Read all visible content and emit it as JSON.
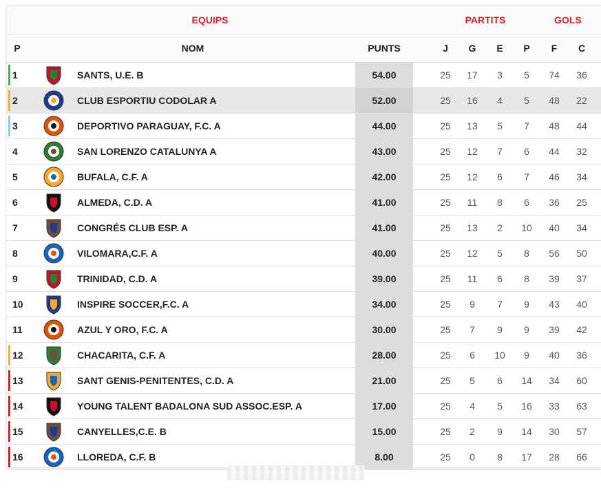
{
  "group_headers": {
    "equips": "EQUIPS",
    "partits": "PARTITS",
    "gols": "GOLS"
  },
  "columns": {
    "p": "P",
    "nom": "NOM",
    "punts": "PUNTS",
    "j": "J",
    "g": "G",
    "e": "E",
    "pp": "P",
    "f": "F",
    "c": "C"
  },
  "colors": {
    "accent": "#d6212a",
    "green": "#4caf50",
    "yellow": "#f0b429",
    "blue": "#8ecfe3",
    "red": "#c62828"
  },
  "rows": [
    {
      "pos": "1",
      "name": "SANTS, U.E. B",
      "pts": "54.00",
      "j": "25",
      "g": "17",
      "e": "3",
      "p": "5",
      "f": "74",
      "c": "36",
      "bar": "#4caf50",
      "crest": "shield-icon"
    },
    {
      "pos": "2",
      "name": "CLUB ESPORTIU CODOLAR A",
      "pts": "52.00",
      "j": "25",
      "g": "16",
      "e": "4",
      "p": "5",
      "f": "48",
      "c": "22",
      "bar": "#f0b429",
      "crest": "round-crest-icon"
    },
    {
      "pos": "3",
      "name": "DEPORTIVO PARAGUAY, F.C. A",
      "pts": "44.00",
      "j": "25",
      "g": "13",
      "e": "5",
      "p": "7",
      "f": "48",
      "c": "44",
      "bar": "#8ecfe3",
      "crest": "round-crest-icon"
    },
    {
      "pos": "4",
      "name": "SAN LORENZO CATALUNYA A",
      "pts": "43.00",
      "j": "25",
      "g": "12",
      "e": "7",
      "p": "6",
      "f": "44",
      "c": "32",
      "bar": "",
      "crest": "round-crest-icon"
    },
    {
      "pos": "5",
      "name": "BUFALA, C.F. A",
      "pts": "42.00",
      "j": "25",
      "g": "12",
      "e": "6",
      "p": "7",
      "f": "46",
      "c": "34",
      "bar": "",
      "crest": "round-crest-icon"
    },
    {
      "pos": "6",
      "name": "ALMEDA, C.D. A",
      "pts": "41.00",
      "j": "25",
      "g": "11",
      "e": "8",
      "p": "6",
      "f": "36",
      "c": "25",
      "bar": "",
      "crest": "shield-icon"
    },
    {
      "pos": "7",
      "name": "CONGRÉS CLUB ESP. A",
      "pts": "41.00",
      "j": "25",
      "g": "13",
      "e": "2",
      "p": "10",
      "f": "40",
      "c": "34",
      "bar": "",
      "crest": "shield-icon"
    },
    {
      "pos": "8",
      "name": "VILOMARA,C.F. A",
      "pts": "40.00",
      "j": "25",
      "g": "12",
      "e": "5",
      "p": "8",
      "f": "56",
      "c": "50",
      "bar": "",
      "crest": "round-crest-icon"
    },
    {
      "pos": "9",
      "name": "TRINIDAD, C.D. A",
      "pts": "39.00",
      "j": "25",
      "g": "11",
      "e": "6",
      "p": "8",
      "f": "39",
      "c": "37",
      "bar": "",
      "crest": "shield-icon"
    },
    {
      "pos": "10",
      "name": "INSPIRE SOCCER,F.C. A",
      "pts": "34.00",
      "j": "25",
      "g": "9",
      "e": "7",
      "p": "9",
      "f": "43",
      "c": "40",
      "bar": "",
      "crest": "shield-icon"
    },
    {
      "pos": "11",
      "name": "AZUL Y ORO, F.C. A",
      "pts": "30.00",
      "j": "25",
      "g": "7",
      "e": "9",
      "p": "9",
      "f": "39",
      "c": "42",
      "bar": "",
      "crest": "round-crest-icon"
    },
    {
      "pos": "12",
      "name": "CHACARITA, C.F. A",
      "pts": "28.00",
      "j": "25",
      "g": "6",
      "e": "10",
      "p": "9",
      "f": "40",
      "c": "36",
      "bar": "#f0b429",
      "crest": "shield-icon"
    },
    {
      "pos": "13",
      "name": "SANT GENIS-PENITENTES, C.D. A",
      "pts": "21.00",
      "j": "25",
      "g": "5",
      "e": "6",
      "p": "14",
      "f": "34",
      "c": "60",
      "bar": "#c62828",
      "crest": "shield-icon"
    },
    {
      "pos": "14",
      "name": "YOUNG TALENT BADALONA SUD ASSOC.ESP. A",
      "pts": "17.00",
      "j": "25",
      "g": "4",
      "e": "5",
      "p": "16",
      "f": "33",
      "c": "63",
      "bar": "#c62828",
      "crest": "shield-icon"
    },
    {
      "pos": "15",
      "name": "CANYELLES,C.E. B",
      "pts": "15.00",
      "j": "25",
      "g": "2",
      "e": "9",
      "p": "14",
      "f": "30",
      "c": "57",
      "bar": "#c62828",
      "crest": "shield-icon"
    },
    {
      "pos": "16",
      "name": "LLOREDA, C.F. B",
      "pts": "8.00",
      "j": "25",
      "g": "0",
      "e": "8",
      "p": "17",
      "f": "28",
      "c": "66",
      "bar": "#c62828",
      "crest": "round-crest-icon"
    }
  ]
}
